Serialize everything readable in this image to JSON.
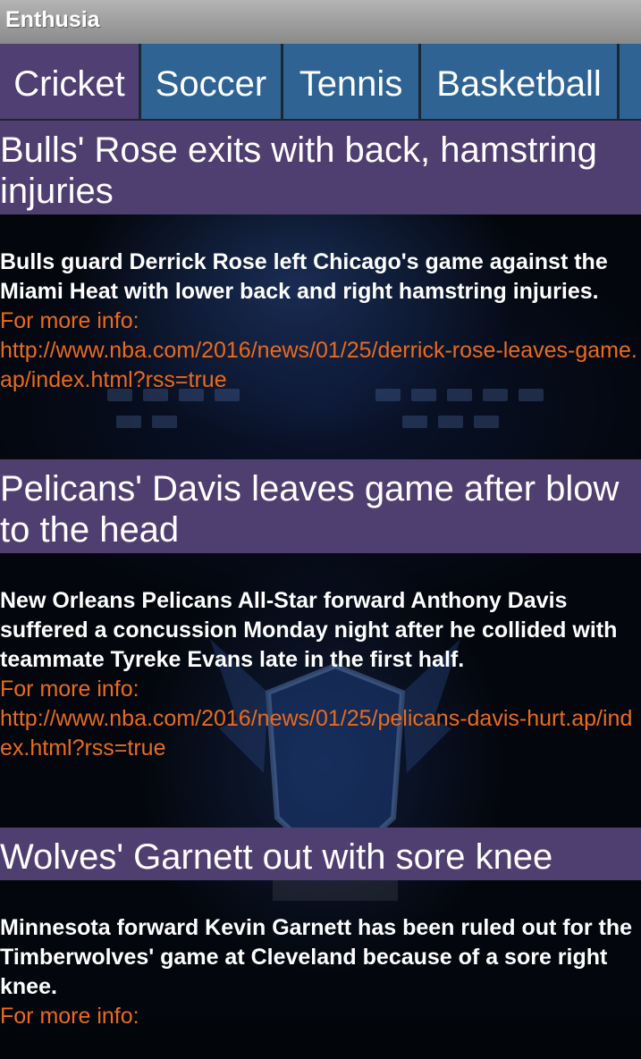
{
  "app": {
    "title": "Enthusia"
  },
  "tabs": [
    {
      "label": "Cricket",
      "active": true
    },
    {
      "label": "Soccer",
      "active": false
    },
    {
      "label": "Tennis",
      "active": false
    },
    {
      "label": "Basketball",
      "active": false
    }
  ],
  "news": [
    {
      "title": "Bulls' Rose exits with back, hamstring injuries",
      "description": "Bulls guard Derrick Rose left Chicago's game against the Miami Heat with lower back and right hamstring injuries.",
      "more_label": "For more info:",
      "link": "http://www.nba.com/2016/news/01/25/derrick-rose-leaves-game.ap/index.html?rss=true"
    },
    {
      "title": "Pelicans' Davis leaves game after blow to the head",
      "description": " New Orleans Pelicans All-Star forward Anthony Davis suffered a concussion Monday night after he collided with teammate Tyreke Evans late in the first half.",
      "more_label": "For more info:",
      "link": "http://www.nba.com/2016/news/01/25/pelicans-davis-hurt.ap/index.html?rss=true"
    },
    {
      "title": "Wolves' Garnett out with sore knee",
      "description": "Minnesota forward Kevin Garnett has been ruled out for the Timberwolves' game at Cleveland because of a sore right knee.",
      "more_label": "For more info:",
      "link": ""
    }
  ],
  "colors": {
    "title_bar": "#9e9e9e",
    "tab_active": "#4f3f72",
    "tab_inactive": "#2e6394",
    "headline_band": "#4f3f70",
    "link": "#e86b1e"
  }
}
